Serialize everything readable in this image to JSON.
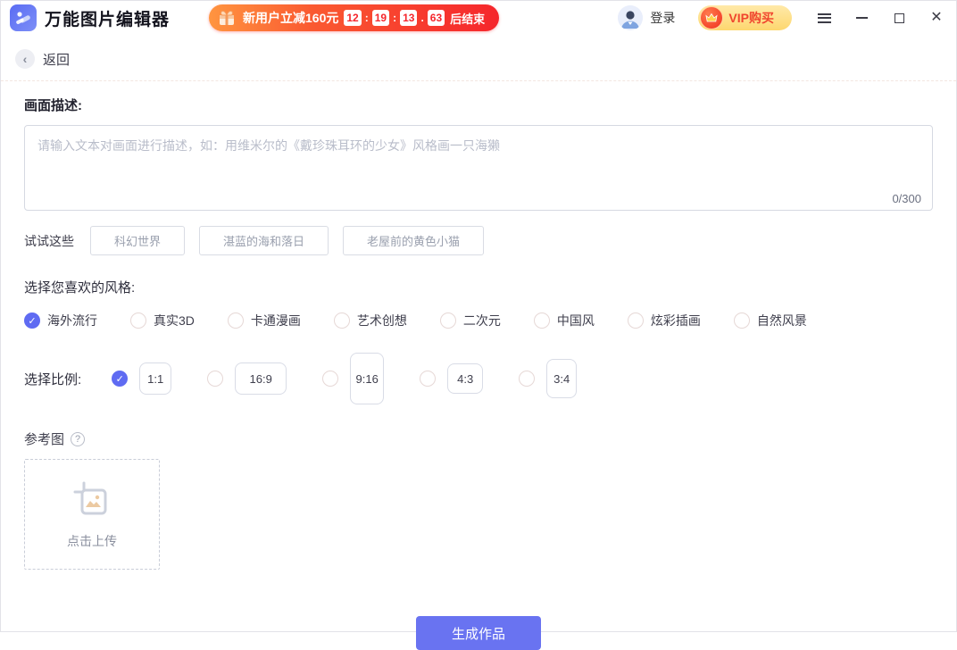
{
  "window": {
    "app_title": "万能图片编辑器"
  },
  "promo": {
    "prefix": "新用户立减160元",
    "countdown": {
      "hours": "12",
      "minutes": "19",
      "seconds": "13",
      "ms": "63"
    },
    "sep_colon1": ":",
    "sep_colon2": ":",
    "sep_dot": ".",
    "suffix": "后结束"
  },
  "account": {
    "login_label": "登录",
    "vip_label": "VIP购买"
  },
  "nav": {
    "back_label": "返回"
  },
  "description": {
    "label": "画面描述:",
    "placeholder": "请输入文本对画面进行描述，如：用维米尔的《戴珍珠耳环的少女》风格画一只海獭",
    "counter": "0/300"
  },
  "suggestions": {
    "label": "试试这些",
    "items": [
      "科幻世界",
      "湛蓝的海和落日",
      "老屋前的黄色小猫"
    ]
  },
  "styles": {
    "label": "选择您喜欢的风格:",
    "check_glyph": "✓",
    "options": [
      {
        "label": "海外流行",
        "selected": true
      },
      {
        "label": "真实3D",
        "selected": false
      },
      {
        "label": "卡通漫画",
        "selected": false
      },
      {
        "label": "艺术创想",
        "selected": false
      },
      {
        "label": "二次元",
        "selected": false
      },
      {
        "label": "中国风",
        "selected": false
      },
      {
        "label": "炫彩插画",
        "selected": false
      },
      {
        "label": "自然风景",
        "selected": false
      }
    ]
  },
  "ratios": {
    "label": "选择比例:",
    "options": [
      {
        "label": "1:1",
        "selected": true
      },
      {
        "label": "16:9",
        "selected": false
      },
      {
        "label": "9:16",
        "selected": false
      },
      {
        "label": "4:3",
        "selected": false
      },
      {
        "label": "3:4",
        "selected": false
      }
    ]
  },
  "reference": {
    "label": "参考图",
    "help_glyph": "?",
    "upload_label": "点击上传"
  },
  "generate": {
    "label": "生成作品"
  },
  "misc": {
    "back_chevron": "‹"
  },
  "colors": {
    "accent": "#5f6bf2",
    "generate_bg": "#6973f1",
    "banner_gradient_start": "#ff9540",
    "banner_gradient_end": "#f5262c",
    "vip_text": "#f0452e",
    "vip_bg": "#fdd76f"
  }
}
